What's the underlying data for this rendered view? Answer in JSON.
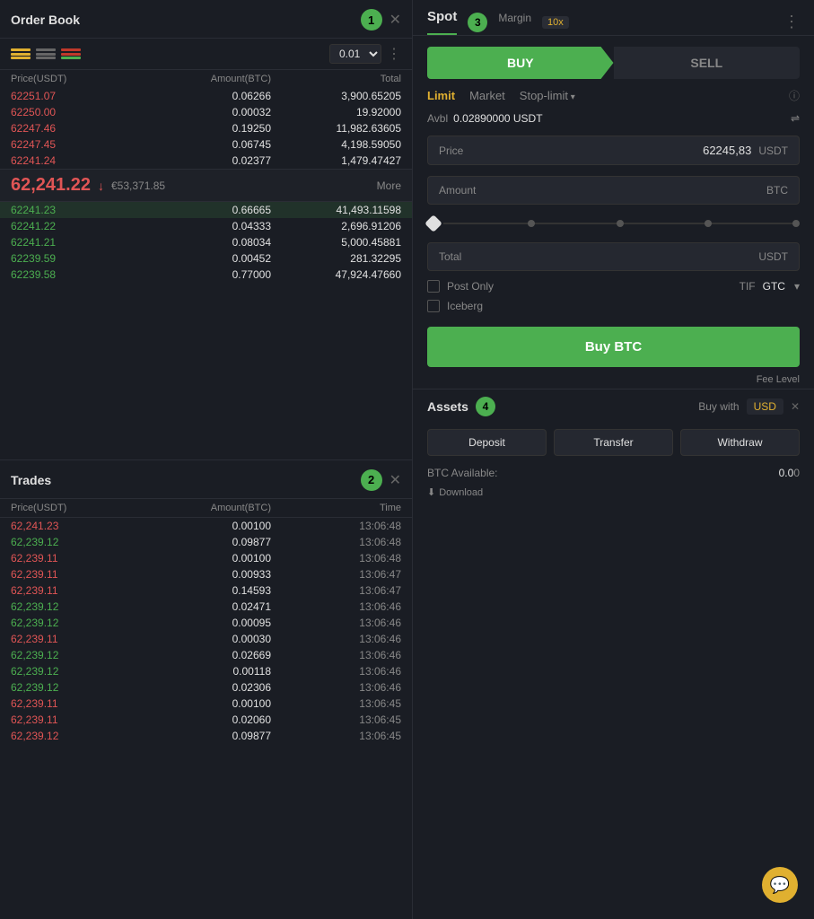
{
  "orderBook": {
    "title": "Order Book",
    "badge": "1",
    "decimal": "0.01",
    "colPrice": "Price(USDT)",
    "colAmount": "Amount(BTC)",
    "colTotal": "Total",
    "askRows": [
      {
        "price": "62251.07",
        "amount": "0.06266",
        "total": "3,900.65205"
      },
      {
        "price": "62250.00",
        "amount": "0.00032",
        "total": "19.92000"
      },
      {
        "price": "62247.46",
        "amount": "0.19250",
        "total": "11,982.63605"
      },
      {
        "price": "62247.45",
        "amount": "0.06745",
        "total": "4,198.59050"
      },
      {
        "price": "62241.24",
        "amount": "0.02377",
        "total": "1,479.47427"
      }
    ],
    "midPrice": "62,241.22",
    "midPriceEur": "€53,371.85",
    "midPriceMore": "More",
    "bidRows": [
      {
        "price": "62241.23",
        "amount": "0.66665",
        "total": "41,493.11598",
        "highlighted": true
      },
      {
        "price": "62241.22",
        "amount": "0.04333",
        "total": "2,696.91206"
      },
      {
        "price": "62241.21",
        "amount": "0.08034",
        "total": "5,000.45881"
      },
      {
        "price": "62239.59",
        "amount": "0.00452",
        "total": "281.32295"
      },
      {
        "price": "62239.58",
        "amount": "0.77000",
        "total": "47,924.47660"
      }
    ]
  },
  "trades": {
    "title": "Trades",
    "badge": "2",
    "colPrice": "Price(USDT)",
    "colAmount": "Amount(BTC)",
    "colTime": "Time",
    "rows": [
      {
        "price": "62,241.23",
        "color": "red",
        "amount": "0.00100",
        "time": "13:06:48"
      },
      {
        "price": "62,239.12",
        "color": "green",
        "amount": "0.09877",
        "time": "13:06:48"
      },
      {
        "price": "62,239.11",
        "color": "red",
        "amount": "0.00100",
        "time": "13:06:48"
      },
      {
        "price": "62,239.11",
        "color": "red",
        "amount": "0.00933",
        "time": "13:06:47"
      },
      {
        "price": "62,239.11",
        "color": "red",
        "amount": "0.14593",
        "time": "13:06:47"
      },
      {
        "price": "62,239.12",
        "color": "green",
        "amount": "0.02471",
        "time": "13:06:46"
      },
      {
        "price": "62,239.12",
        "color": "green",
        "amount": "0.00095",
        "time": "13:06:46"
      },
      {
        "price": "62,239.11",
        "color": "red",
        "amount": "0.00030",
        "time": "13:06:46"
      },
      {
        "price": "62,239.12",
        "color": "green",
        "amount": "0.02669",
        "time": "13:06:46"
      },
      {
        "price": "62,239.12",
        "color": "green",
        "amount": "0.00118",
        "time": "13:06:46"
      },
      {
        "price": "62,239.12",
        "color": "green",
        "amount": "0.02306",
        "time": "13:06:46"
      },
      {
        "price": "62,239.11",
        "color": "red",
        "amount": "0.00100",
        "time": "13:06:45"
      },
      {
        "price": "62,239.11",
        "color": "red",
        "amount": "0.02060",
        "time": "13:06:45"
      },
      {
        "price": "62,239.12",
        "color": "red",
        "amount": "0.09877",
        "time": "13:06:45"
      }
    ]
  },
  "spot": {
    "title": "Spot",
    "badge": "3",
    "marginLabel": "Margin",
    "leverageLabel": "10x",
    "buyLabel": "BUY",
    "sellLabel": "SELL",
    "limitLabel": "Limit",
    "marketLabel": "Market",
    "stopLimitLabel": "Stop-limit",
    "avblLabel": "Avbl",
    "avblValue": "0.02890000 USDT",
    "priceLabel": "Price",
    "priceValue": "62245,83",
    "priceUnit": "USDT",
    "amountLabel": "Amount",
    "amountUnit": "BTC",
    "totalLabel": "Total",
    "totalUnit": "USDT",
    "postOnlyLabel": "Post Only",
    "tifLabel": "TIF",
    "tifValue": "GTC",
    "icebergLabel": "Iceberg",
    "buyBtcLabel": "Buy BTC",
    "feeLevelLabel": "Fee Level"
  },
  "assets": {
    "title": "Assets",
    "badge": "4",
    "buyWithLabel": "Buy with",
    "currencyLabel": "USD",
    "depositLabel": "Deposit",
    "transferLabel": "Transfer",
    "withdrawLabel": "Withdraw",
    "btcAvailLabel": "BTC Available:",
    "btcAvailValue": "0.0",
    "downloadLabel": "Download"
  },
  "colors": {
    "green": "#4caf50",
    "red": "#e05555",
    "gold": "#e0b030",
    "bg": "#1a1d24",
    "panel": "#252830"
  }
}
